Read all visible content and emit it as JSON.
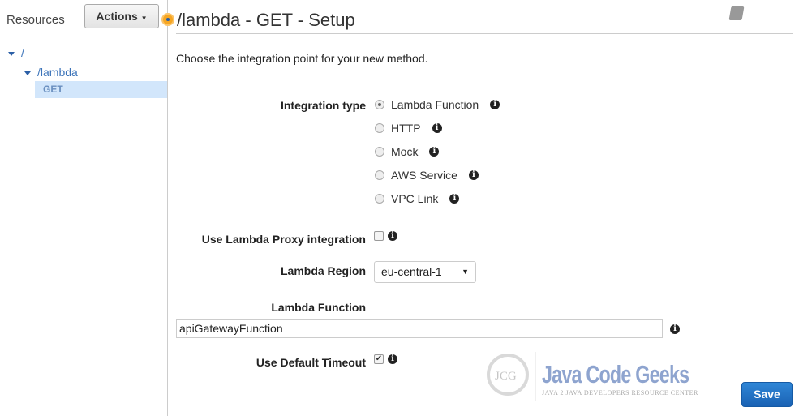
{
  "sidebar": {
    "title": "Resources",
    "actions_label": "Actions",
    "tree": [
      {
        "label": "/"
      },
      {
        "label": "/lambda"
      },
      {
        "label": "GET"
      }
    ]
  },
  "header": {
    "title": "/lambda - GET - Setup"
  },
  "intro": "Choose the integration point for your new method.",
  "form": {
    "integration_type_label": "Integration type",
    "integration_options": [
      "Lambda Function",
      "HTTP",
      "Mock",
      "AWS Service",
      "VPC Link"
    ],
    "integration_selected": "Lambda Function",
    "proxy_label": "Use Lambda Proxy integration",
    "proxy_checked": false,
    "region_label": "Lambda Region",
    "region_value": "eu-central-1",
    "function_label": "Lambda Function",
    "function_value": "apiGatewayFunction",
    "timeout_label": "Use Default Timeout",
    "timeout_checked": true,
    "check_mark": "✔"
  },
  "save_label": "Save",
  "watermark": {
    "logo": "JCG",
    "title": "Java Code Geeks",
    "subtitle": "JAVA 2 JAVA DEVELOPERS RESOURCE CENTER"
  },
  "colors": {
    "accent": "#1a62b4",
    "link": "#3b73b9",
    "selected": "#d2e6fb"
  }
}
